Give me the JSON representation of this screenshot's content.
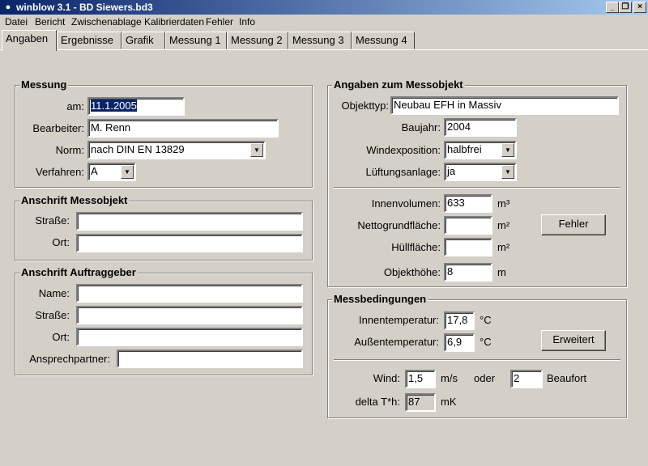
{
  "window": {
    "title": "winblow 3.1 - BD Siewers.bd3",
    "minimize": "_",
    "restore": "❐",
    "close": "×"
  },
  "menu": [
    "Datei",
    "Bericht",
    "Zwischenablage",
    "Kalibrierdaten",
    "Fehler",
    "Info"
  ],
  "tabs": [
    "Angaben",
    "Ergebnisse",
    "Grafik",
    "Messung 1",
    "Messung 2",
    "Messung 3",
    "Messung 4"
  ],
  "messung": {
    "title": "Messung",
    "am_label": "am:",
    "am_value": "11.1.2005",
    "bearbeiter_label": "Bearbeiter:",
    "bearbeiter_value": "M. Renn",
    "norm_label": "Norm:",
    "norm_value": "nach DIN EN 13829",
    "verfahren_label": "Verfahren:",
    "verfahren_value": "A"
  },
  "anschrift_messobjekt": {
    "title": "Anschrift Messobjekt",
    "strasse_label": "Straße:",
    "strasse_value": "",
    "ort_label": "Ort:",
    "ort_value": ""
  },
  "anschrift_auftraggeber": {
    "title": "Anschrift Auftraggeber",
    "name_label": "Name:",
    "name_value": "",
    "strasse_label": "Straße:",
    "strasse_value": "",
    "ort_label": "Ort:",
    "ort_value": "",
    "ansprech_label": "Ansprechpartner:",
    "ansprech_value": ""
  },
  "messobjekt": {
    "title": "Angaben zum Messobjekt",
    "objekttyp_label": "Objekttyp:",
    "objekttyp_value": "Neubau EFH in Massiv",
    "baujahr_label": "Baujahr:",
    "baujahr_value": "2004",
    "wind_label": "Windexposition:",
    "wind_value": "halbfrei",
    "lueftung_label": "Lüftungsanlage:",
    "lueftung_value": "ja",
    "innenvolumen_label": "Innenvolumen:",
    "innenvolumen_value": "633",
    "innenvolumen_unit": "m³",
    "netto_label": "Nettogrundfläche:",
    "netto_value": "",
    "netto_unit": "m²",
    "huell_label": "Hüllfläche:",
    "huell_value": "",
    "huell_unit": "m²",
    "hoehe_label": "Objekthöhe:",
    "hoehe_value": "8",
    "hoehe_unit": "m",
    "fehler_button": "Fehler"
  },
  "messbedingungen": {
    "title": "Messbedingungen",
    "innen_label": "Innentemperatur:",
    "innen_value": "17,8",
    "innen_unit": "°C",
    "aussen_label": "Außentemperatur:",
    "aussen_value": "6,9",
    "aussen_unit": "°C",
    "erweitert_button": "Erweitert",
    "wind_label": "Wind:",
    "wind_value": "1,5",
    "wind_unit": "m/s",
    "oder": "oder",
    "beaufort_value": "2",
    "beaufort_unit": "Beaufort",
    "delta_label": "delta T*h:",
    "delta_value": "87",
    "delta_unit": "mK"
  }
}
